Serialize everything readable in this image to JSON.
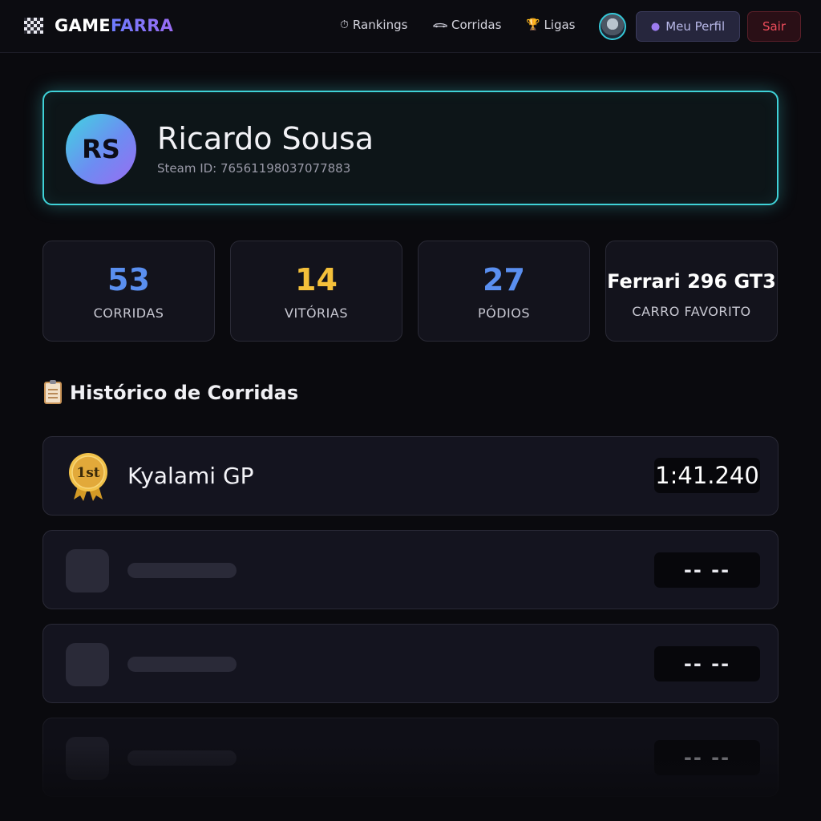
{
  "brand": {
    "part1": "GAME",
    "part2": "FARRA"
  },
  "nav": {
    "rankings": {
      "icon": "stopwatch-icon",
      "label": "Rankings"
    },
    "corridas": {
      "icon": "race-car-icon",
      "label": "Corridas"
    },
    "ligas": {
      "icon": "trophy-icon",
      "label": "Ligas"
    }
  },
  "user_menu": {
    "profile_label": "Meu Perfil",
    "logout_label": "Sair"
  },
  "profile": {
    "initials": "RS",
    "name": "Ricardo Sousa",
    "steam_id": "Steam ID:  76561198037077883"
  },
  "stats": [
    {
      "value": "53",
      "label": "CORRIDAS",
      "color": "#5a8ff0"
    },
    {
      "value": "14",
      "label": "VITÓRIAS",
      "color": "#f4c03a"
    },
    {
      "value": "27",
      "label": "PÓDIOS",
      "color": "#5a8ff0"
    },
    {
      "value": "Ferrari 296 GT3",
      "label": "CARRO FAVORITO",
      "color": "#ffffff"
    }
  ],
  "history": {
    "title": "Histórico de Corridas",
    "races": [
      {
        "position_badge": "1st",
        "track": "Kyalami GP",
        "time": "1:41.240"
      },
      {
        "time": "-- --"
      },
      {
        "time": "-- --"
      },
      {
        "time": "-- --"
      }
    ]
  }
}
